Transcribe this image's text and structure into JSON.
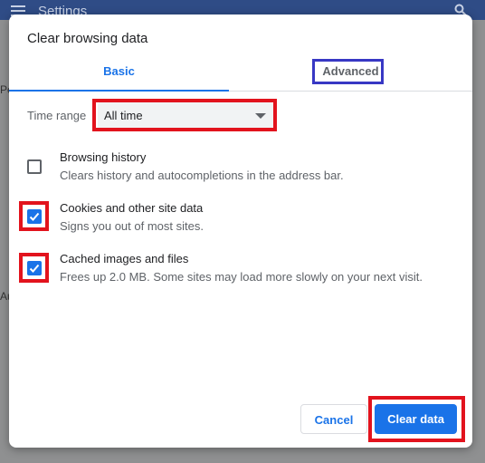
{
  "background": {
    "title": "Settings",
    "left_fragments": [
      "Pe",
      "Au"
    ]
  },
  "dialog": {
    "title": "Clear browsing data",
    "tabs": [
      {
        "label": "Basic",
        "selected": true
      },
      {
        "label": "Advanced",
        "selected": false
      }
    ],
    "time_range": {
      "label": "Time range",
      "value": "All time"
    },
    "items": [
      {
        "title": "Browsing history",
        "description": "Clears history and autocompletions in the address bar.",
        "checked": false
      },
      {
        "title": "Cookies and other site data",
        "description": "Signs you out of most sites.",
        "checked": true
      },
      {
        "title": "Cached images and files",
        "description": "Frees up 2.0 MB. Some sites may load more slowly on your next visit.",
        "checked": true
      }
    ],
    "buttons": {
      "cancel": "Cancel",
      "clear": "Clear data"
    }
  },
  "colors": {
    "accent": "#1a73e8",
    "highlight_red": "#e2131d",
    "highlight_blue": "#3838c4"
  },
  "icons": {
    "menu": "hamburger-menu-icon",
    "search": "search-icon",
    "dropdown": "caret-down-icon",
    "check": "checkmark-icon"
  }
}
